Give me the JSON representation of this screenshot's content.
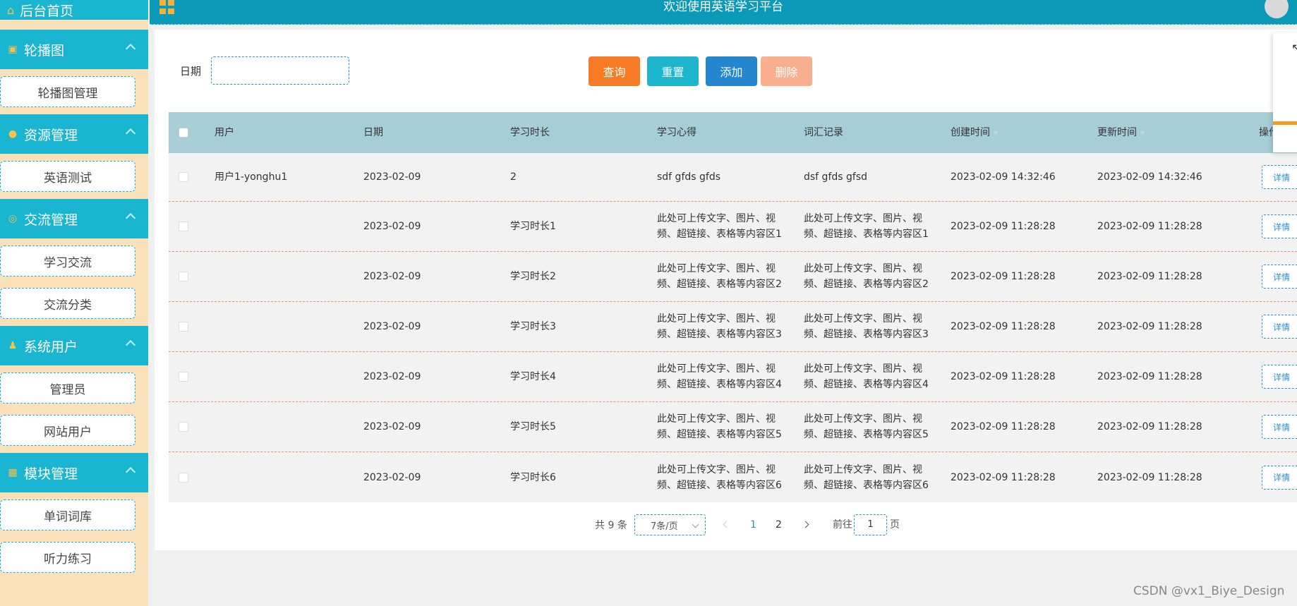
{
  "header": {
    "title": "欢迎使用英语学习平台"
  },
  "sidebar": {
    "home": "后台首页",
    "groups": [
      {
        "title": "轮播图",
        "icon": "image-icon",
        "items": [
          "轮播图管理"
        ]
      },
      {
        "title": "资源管理",
        "icon": "location-pin-icon",
        "items": [
          "英语测试"
        ]
      },
      {
        "title": "交流管理",
        "icon": "chat-icon",
        "items": [
          "学习交流",
          "交流分类"
        ]
      },
      {
        "title": "系统用户",
        "icon": "user-icon",
        "items": [
          "管理员",
          "网站用户"
        ]
      },
      {
        "title": "模块管理",
        "icon": "grid-icon",
        "items": [
          "单词词库",
          "听力练习"
        ]
      }
    ]
  },
  "search": {
    "label": "日期",
    "value": ""
  },
  "buttons": {
    "query": "查询",
    "reset": "重置",
    "add": "添加",
    "delete": "删除"
  },
  "table": {
    "columns": [
      "用户",
      "日期",
      "学习时长",
      "学习心得",
      "词汇记录",
      "创建时间",
      "更新时间",
      "操作"
    ],
    "detail_label": "详情",
    "rows": [
      {
        "user": "用户1-yonghu1",
        "date": "2023-02-09",
        "duration": "2",
        "notes": "sdf gfds gfds",
        "vocab": "dsf gfds gfsd",
        "created": "2023-02-09 14:32:46",
        "updated": "2023-02-09 14:32:46"
      },
      {
        "user": "",
        "date": "2023-02-09",
        "duration": "学习时长1",
        "notes": "此处可上传文字、图片、视频、超链接、表格等内容区1",
        "vocab": "此处可上传文字、图片、视频、超链接、表格等内容区1",
        "created": "2023-02-09 11:28:28",
        "updated": "2023-02-09 11:28:28"
      },
      {
        "user": "",
        "date": "2023-02-09",
        "duration": "学习时长2",
        "notes": "此处可上传文字、图片、视频、超链接、表格等内容区2",
        "vocab": "此处可上传文字、图片、视频、超链接、表格等内容区2",
        "created": "2023-02-09 11:28:28",
        "updated": "2023-02-09 11:28:28"
      },
      {
        "user": "",
        "date": "2023-02-09",
        "duration": "学习时长3",
        "notes": "此处可上传文字、图片、视频、超链接、表格等内容区3",
        "vocab": "此处可上传文字、图片、视频、超链接、表格等内容区3",
        "created": "2023-02-09 11:28:28",
        "updated": "2023-02-09 11:28:28"
      },
      {
        "user": "",
        "date": "2023-02-09",
        "duration": "学习时长4",
        "notes": "此处可上传文字、图片、视频、超链接、表格等内容区4",
        "vocab": "此处可上传文字、图片、视频、超链接、表格等内容区4",
        "created": "2023-02-09 11:28:28",
        "updated": "2023-02-09 11:28:28"
      },
      {
        "user": "",
        "date": "2023-02-09",
        "duration": "学习时长5",
        "notes": "此处可上传文字、图片、视频、超链接、表格等内容区5",
        "vocab": "此处可上传文字、图片、视频、超链接、表格等内容区5",
        "created": "2023-02-09 11:28:28",
        "updated": "2023-02-09 11:28:28"
      },
      {
        "user": "",
        "date": "2023-02-09",
        "duration": "学习时长6",
        "notes": "此处可上传文字、图片、视频、超链接、表格等内容区6",
        "vocab": "此处可上传文字、图片、视频、超链接、表格等内容区6",
        "created": "2023-02-09 11:28:28",
        "updated": "2023-02-09 11:28:28"
      }
    ]
  },
  "pagination": {
    "total": "共 9 条",
    "page_size": "7条/页",
    "pages": [
      "1",
      "2"
    ],
    "current": "1",
    "goto_label": "前往",
    "goto_value": "1",
    "page_suffix": "页"
  },
  "watermark": "CSDN @vx1_Biye_Design",
  "colors": {
    "primary": "#1ab5d0",
    "header": "#0a9ab8",
    "sidebar_bg": "#fbe1b9",
    "accent": "#f77b24"
  }
}
